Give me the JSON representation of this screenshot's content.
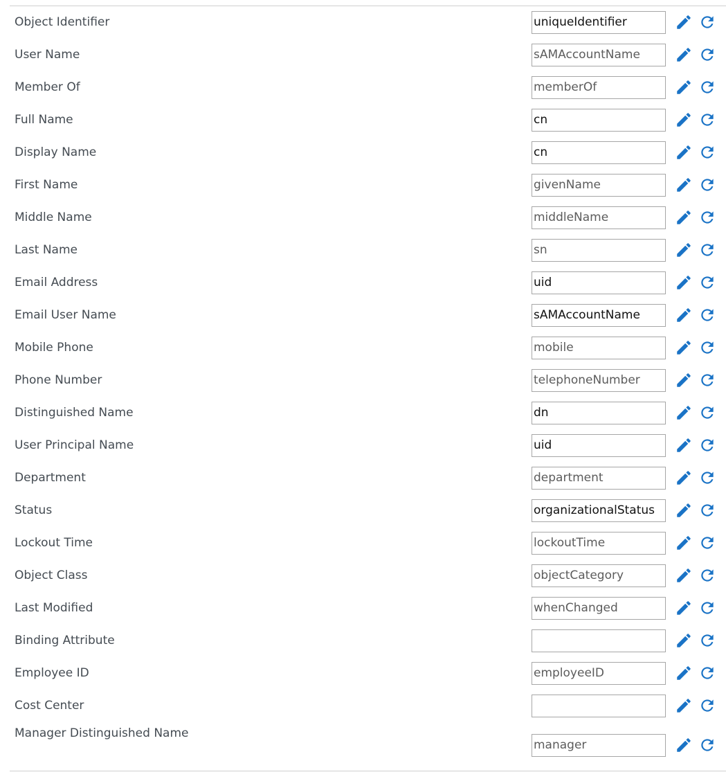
{
  "colors": {
    "icon_blue": "#1a73c6",
    "label_text": "#444b52",
    "field_border": "#a6a6a6",
    "divider": "#cfcfcf"
  },
  "icons": {
    "edit": "pencil-icon",
    "reset": "refresh-icon"
  },
  "rows": [
    {
      "label": "Object Identifier",
      "value": "uniqueIdentifier",
      "is_default": false
    },
    {
      "label": "User Name",
      "value": "sAMAccountName",
      "is_default": true
    },
    {
      "label": "Member Of",
      "value": "memberOf",
      "is_default": true
    },
    {
      "label": "Full Name",
      "value": "cn",
      "is_default": false
    },
    {
      "label": "Display Name",
      "value": "cn",
      "is_default": false
    },
    {
      "label": "First Name",
      "value": "givenName",
      "is_default": true
    },
    {
      "label": "Middle Name",
      "value": "middleName",
      "is_default": true
    },
    {
      "label": "Last Name",
      "value": "sn",
      "is_default": true
    },
    {
      "label": "Email Address",
      "value": "uid",
      "is_default": false
    },
    {
      "label": "Email User Name",
      "value": "sAMAccountName",
      "is_default": false
    },
    {
      "label": "Mobile Phone",
      "value": "mobile",
      "is_default": true
    },
    {
      "label": "Phone Number",
      "value": "telephoneNumber",
      "is_default": true
    },
    {
      "label": "Distinguished Name",
      "value": "dn",
      "is_default": false
    },
    {
      "label": "User Principal Name",
      "value": "uid",
      "is_default": false
    },
    {
      "label": "Department",
      "value": "department",
      "is_default": true
    },
    {
      "label": "Status",
      "value": "organizationalStatus",
      "is_default": false
    },
    {
      "label": "Lockout Time",
      "value": "lockoutTime",
      "is_default": true
    },
    {
      "label": "Object Class",
      "value": "objectCategory",
      "is_default": true
    },
    {
      "label": "Last Modified",
      "value": "whenChanged",
      "is_default": true
    },
    {
      "label": "Binding Attribute",
      "value": "",
      "is_default": true
    },
    {
      "label": "Employee ID",
      "value": "employeeID",
      "is_default": true
    },
    {
      "label": "Cost Center",
      "value": "",
      "is_default": true
    },
    {
      "label": "Manager Distinguished Name",
      "value": "manager",
      "is_default": true
    }
  ]
}
